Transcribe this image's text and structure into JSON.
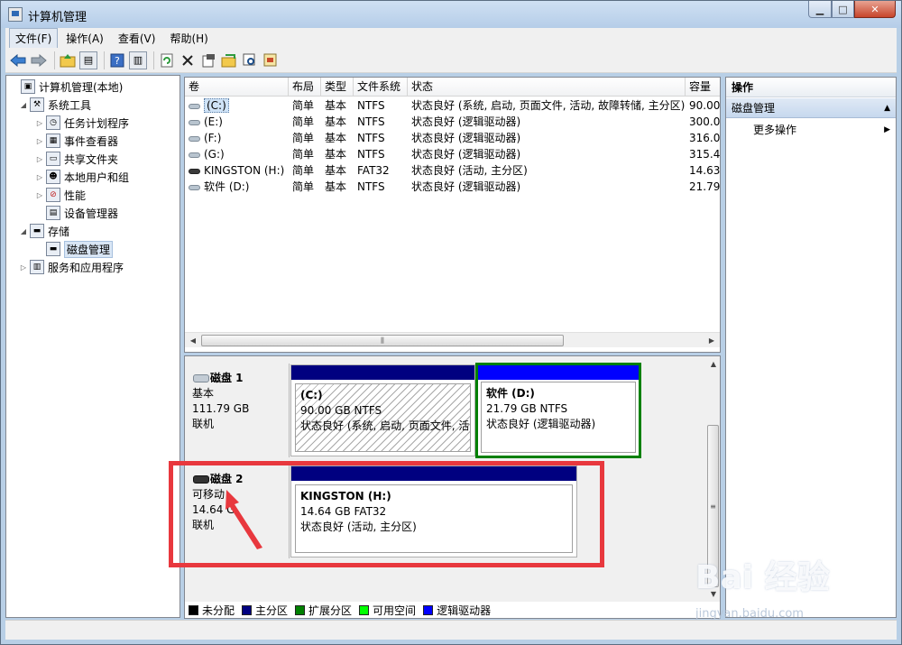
{
  "window": {
    "title": "计算机管理"
  },
  "menu": [
    "文件(F)",
    "操作(A)",
    "查看(V)",
    "帮助(H)"
  ],
  "toolbar": {
    "icons": [
      "back-arrow-icon",
      "forward-arrow-icon",
      "up-folder-icon",
      "show-tree-icon",
      "help-icon",
      "properties-pane-icon",
      "refresh-icon",
      "delete-icon",
      "properties-icon",
      "open-icon",
      "search-icon",
      "export-icon"
    ]
  },
  "tree": {
    "root": "计算机管理(本地)",
    "system_tools": "系统工具",
    "task_scheduler": "任务计划程序",
    "event_viewer": "事件查看器",
    "shared_folders": "共享文件夹",
    "local_users": "本地用户和组",
    "performance": "性能",
    "device_manager": "设备管理器",
    "storage": "存储",
    "disk_management": "磁盘管理",
    "services": "服务和应用程序"
  },
  "volumes": {
    "headers": {
      "volume": "卷",
      "layout": "布局",
      "type": "类型",
      "fs": "文件系统",
      "status": "状态",
      "capacity": "容量"
    },
    "rows": [
      {
        "volume": "(C:)",
        "layout": "简单",
        "type": "基本",
        "fs": "NTFS",
        "status": "状态良好 (系统, 启动, 页面文件, 活动, 故障转储, 主分区)",
        "capacity": "90.00"
      },
      {
        "volume": "(E:)",
        "layout": "简单",
        "type": "基本",
        "fs": "NTFS",
        "status": "状态良好 (逻辑驱动器)",
        "capacity": "300.0"
      },
      {
        "volume": "(F:)",
        "layout": "简单",
        "type": "基本",
        "fs": "NTFS",
        "status": "状态良好 (逻辑驱动器)",
        "capacity": "316.0"
      },
      {
        "volume": "(G:)",
        "layout": "简单",
        "type": "基本",
        "fs": "NTFS",
        "status": "状态良好 (逻辑驱动器)",
        "capacity": "315.4"
      },
      {
        "volume": "KINGSTON (H:)",
        "layout": "简单",
        "type": "基本",
        "fs": "FAT32",
        "status": "状态良好 (活动, 主分区)",
        "capacity": "14.63"
      },
      {
        "volume": "软件 (D:)",
        "layout": "简单",
        "type": "基本",
        "fs": "NTFS",
        "status": "状态良好 (逻辑驱动器)",
        "capacity": "21.79"
      }
    ]
  },
  "disks": {
    "disk1": {
      "name": "磁盘 1",
      "type": "基本",
      "size": "111.79 GB",
      "state": "联机",
      "p1": {
        "title": "(C:)",
        "size": "90.00 GB NTFS",
        "status": "状态良好 (系统, 启动, 页面文件, 活动"
      },
      "p2": {
        "title": "软件  (D:)",
        "size": "21.79 GB NTFS",
        "status": "状态良好 (逻辑驱动器)"
      }
    },
    "disk2": {
      "name": "磁盘 2",
      "type": "可移动",
      "size": "14.64 G",
      "state": "联机",
      "p1": {
        "title": "KINGSTON  (H:)",
        "size": "14.64 GB FAT32",
        "status": "状态良好 (活动, 主分区)"
      }
    }
  },
  "legend": [
    {
      "label": "未分配",
      "color": "#000000"
    },
    {
      "label": "主分区",
      "color": "#000080"
    },
    {
      "label": "扩展分区",
      "color": "#008000"
    },
    {
      "label": "可用空间",
      "color": "#00ff00"
    },
    {
      "label": "逻辑驱动器",
      "color": "#0000ff"
    }
  ],
  "actions": {
    "header": "操作",
    "section": "磁盘管理",
    "more": "更多操作"
  },
  "watermark": {
    "brand": "Bai 经验",
    "url": "jingyan.baidu.com"
  },
  "colors": {
    "primary_partition": "#000080",
    "logical_drive": "#0000ff",
    "extended": "#008000",
    "highlight": "#e8383e"
  }
}
